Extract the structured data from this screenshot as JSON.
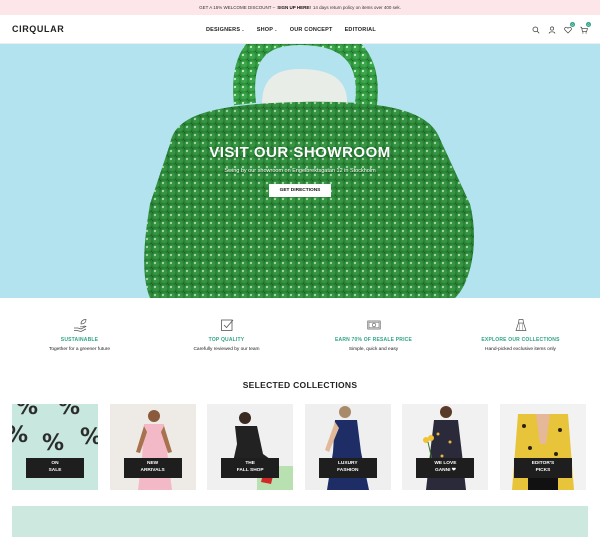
{
  "topbar": {
    "promo": "GET A 15% WELCOME DISCOUNT –",
    "signup": "SIGN UP HERE!",
    "returns": "14 days return policy on items over 400 sek."
  },
  "header": {
    "logo": "CIRQULAR",
    "nav": [
      {
        "label": "DESIGNERS",
        "has_dropdown": true
      },
      {
        "label": "SHOP",
        "has_dropdown": true
      },
      {
        "label": "OUR CONCEPT",
        "has_dropdown": false
      },
      {
        "label": "EDITORIAL",
        "has_dropdown": false
      }
    ],
    "wishlist_count": "0",
    "cart_count": "0"
  },
  "hero": {
    "title": "VISIT OUR SHOWROOM",
    "subtitle": "Swing by our showroom on Engelbrektsgatan 12 in Stockholm",
    "button": "GET DIRECTIONS",
    "bg_color": "#b2e3ee",
    "bag_color": "#2f8f3c"
  },
  "features": [
    {
      "icon": "hand-leaf-icon",
      "title": "SUSTAINABLE",
      "desc": "Together for a greener future"
    },
    {
      "icon": "check-box-icon",
      "title": "TOP QUALITY",
      "desc": "Carefully reviewed by our team"
    },
    {
      "icon": "money-note-icon",
      "title": "EARN 70% OF RESALE PRICE",
      "desc": "Simple, quick and easy"
    },
    {
      "icon": "dress-icon",
      "title": "EXPLORE OUR COLLECTIONS",
      "desc": "Hand-picked exclusive items only"
    }
  ],
  "accent_color": "#2fa384",
  "collections_title": "SELECTED COLLECTIONS",
  "collections": [
    {
      "label": "ON\nSALE"
    },
    {
      "label": "NEW\nARRIVALS"
    },
    {
      "label": "THE\nFALL SHOP"
    },
    {
      "label": "LUXURY\nFASHION"
    },
    {
      "label": "WE LOVE\nGANNI ❤"
    },
    {
      "label": "EDITOR'S\nPICKS"
    }
  ]
}
